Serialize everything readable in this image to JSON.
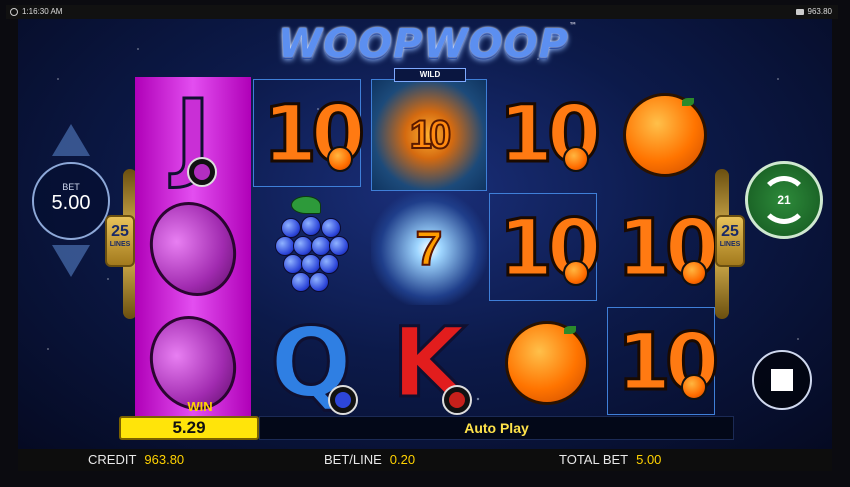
{
  "status_bar": {
    "time": "1:16:30 AM",
    "balance": "963.80",
    "icons": [
      "clock-icon",
      "wallet-icon"
    ]
  },
  "game": {
    "title": "WOOPWOOP",
    "trademark": "™",
    "wild_label": "WILD",
    "wild_symbol_text": "10"
  },
  "reels": [
    [
      "J",
      "plum",
      "plum"
    ],
    [
      "10",
      "grapes",
      "Q"
    ],
    [
      "WILD 10",
      "7",
      "K"
    ],
    [
      "10",
      "10",
      "orange"
    ],
    [
      "orange",
      "10",
      "10"
    ]
  ],
  "symbols": {
    "ten": "10",
    "j": "J",
    "q": "Q",
    "k": "K",
    "seven": "7"
  },
  "controls": {
    "bet_label": "BET",
    "bet_value": "5.00",
    "lines_count": "25",
    "lines_label": "LINES",
    "autospin_count": "21"
  },
  "win": {
    "label": "WIN",
    "value": "5.29"
  },
  "auto_play": "Auto Play",
  "footer": {
    "credit_label": "CREDIT",
    "credit_value": "963.80",
    "betline_label": "BET/LINE",
    "betline_value": "0.20",
    "totalbet_label": "TOTAL BET",
    "totalbet_value": "5.00"
  },
  "colors": {
    "accent_gold": "#ffd200",
    "win_box": "#ffe40a",
    "spin_green": "#2d8a3a",
    "orange_ten": "#ff7a12",
    "plum_magenta": "#c92fd6"
  }
}
